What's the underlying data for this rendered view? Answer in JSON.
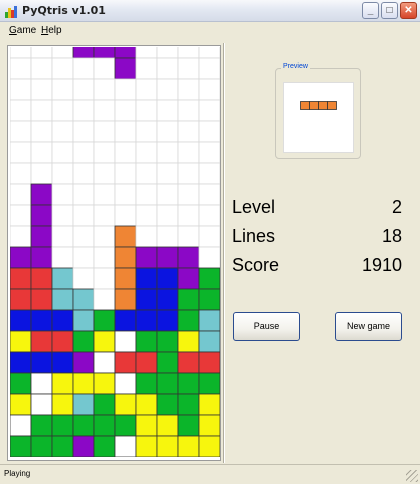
{
  "window": {
    "title": "PyQtris v1.01",
    "minimize": "_",
    "maximize": "□",
    "close": "✕"
  },
  "menu": {
    "items": [
      "Game",
      "Help"
    ]
  },
  "preview": {
    "title": "Preview",
    "piece_color": "#ef8534",
    "piece_blocks": 4
  },
  "stats": [
    {
      "label": "Level",
      "value": "2"
    },
    {
      "label": "Lines",
      "value": "18"
    },
    {
      "label": "Score",
      "value": "1910"
    }
  ],
  "buttons": {
    "pause": "Pause",
    "new_game": "New game"
  },
  "status": {
    "text": "Playing"
  },
  "board": {
    "columns": 10,
    "rows": 20,
    "colors": {
      "P": "#8b08c6",
      "O": "#ef8534",
      "R": "#e83838",
      "C": "#74c7cf",
      "B": "#0b14e0",
      "G": "#0bb52a",
      "Y": "#f7f60d",
      "W": "#ffffff",
      "E": ""
    },
    "grid": [
      "EEEEEEEEEE",
      "EEEPPPEEEE",
      "EEEEEPEEEE",
      "EEEEEEEEEE",
      "EEEEEEEEEE",
      "EEEEEEEEEE",
      "EEEEEEEEEE",
      "EEEEEEEEEE",
      "EPEEEEEEEE",
      "EPEEEEEEEE",
      "EPEEEOEEEE",
      "PPEEEOPPPE",
      "RRCEEOBBPG",
      "RRCCEOBBGG",
      "BBBCGBBBGC",
      "YRRGYWGGYC",
      "BBBPWRRGRR",
      "GWYYYWGGGG",
      "YWYCGYYGGY",
      "WGGGGGYYGY",
      "GGGPGWYYYY"
    ]
  }
}
